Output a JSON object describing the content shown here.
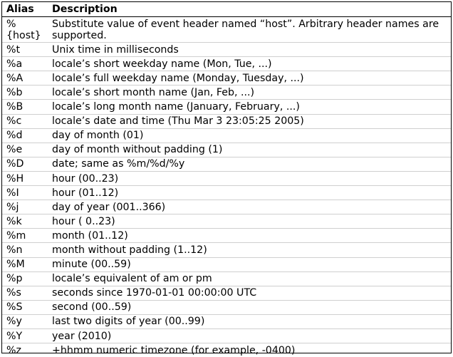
{
  "headers": {
    "alias": "Alias",
    "description": "Description"
  },
  "rows": [
    {
      "alias": "% {host}",
      "description": "Substitute value of event header named “host”. Arbitrary header names are supported."
    },
    {
      "alias": "%t",
      "description": "Unix time in milliseconds"
    },
    {
      "alias": "%a",
      "description": "locale’s short weekday name (Mon, Tue, ...)"
    },
    {
      "alias": "%A",
      "description": "locale’s full weekday name (Monday, Tuesday, ...)"
    },
    {
      "alias": "%b",
      "description": "locale’s short month name (Jan, Feb, ...)"
    },
    {
      "alias": "%B",
      "description": "locale’s long month name (January, February, ...)"
    },
    {
      "alias": "%c",
      "description": "locale’s date and time (Thu Mar 3 23:05:25 2005)"
    },
    {
      "alias": "%d",
      "description": "day of month (01)"
    },
    {
      "alias": "%e",
      "description": "day of month without padding (1)"
    },
    {
      "alias": "%D",
      "description": "date; same as %m/%d/%y"
    },
    {
      "alias": "%H",
      "description": "hour (00..23)"
    },
    {
      "alias": "%I",
      "description": "hour (01..12)"
    },
    {
      "alias": "%j",
      "description": "day of year (001..366)"
    },
    {
      "alias": "%k",
      "description": "hour ( 0..23)"
    },
    {
      "alias": "%m",
      "description": "month (01..12)"
    },
    {
      "alias": "%n",
      "description": "month without padding (1..12)"
    },
    {
      "alias": "%M",
      "description": "minute (00..59)"
    },
    {
      "alias": "%p",
      "description": "locale’s equivalent of am or pm"
    },
    {
      "alias": "%s",
      "description": "seconds since 1970-01-01 00:00:00 UTC"
    },
    {
      "alias": "%S",
      "description": "second (00..59)"
    },
    {
      "alias": "%y",
      "description": "last two digits of year (00..99)"
    },
    {
      "alias": "%Y",
      "description": "year (2010)"
    },
    {
      "alias": "%z",
      "description": "+hhmm numeric timezone (for example, -0400)"
    }
  ]
}
